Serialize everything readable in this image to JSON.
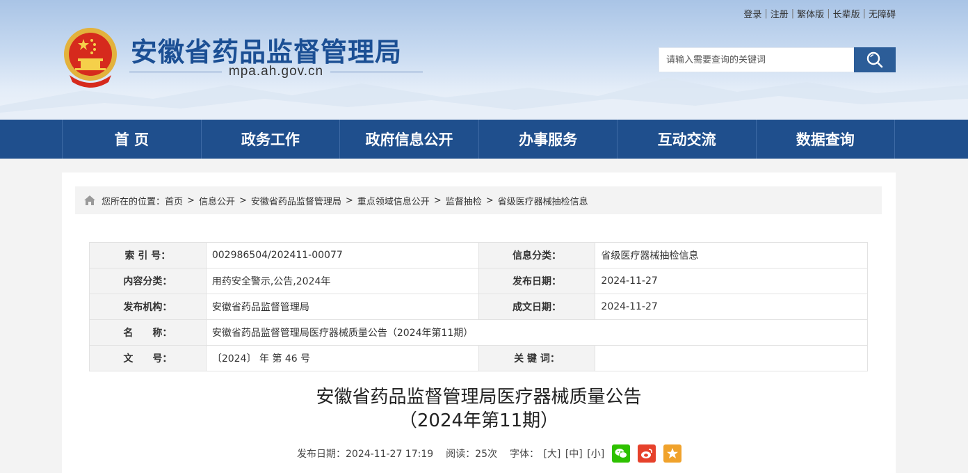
{
  "header": {
    "site_title": "安徽省药品监督管理局",
    "domain": "mpa.ah.gov.cn",
    "toplinks": [
      "登录",
      "注册",
      "繁体版",
      "长辈版",
      "无障碍"
    ],
    "search_placeholder": "请输入需要查询的关键词"
  },
  "nav": [
    "首 页",
    "政务工作",
    "政府信息公开",
    "办事服务",
    "互动交流",
    "数据查询"
  ],
  "breadcrumb": {
    "prefix": "您所在的位置：",
    "items": [
      "首页",
      "信息公开",
      "安徽省药品监督管理局",
      "重点领域信息公开",
      "监督抽检",
      "省级医疗器械抽检信息"
    ]
  },
  "meta": {
    "index_label": "索 引 号：",
    "index_value": "002986504/202411-00077",
    "category_label": "信息分类：",
    "category_value": "省级医疗器械抽检信息",
    "content_label": "内容分类：",
    "content_value": "用药安全警示,公告,2024年",
    "publish_label": "发布日期：",
    "publish_value": "2024-11-27",
    "org_label": "发布机构：",
    "org_value": "安徽省药品监督管理局",
    "written_label": "成文日期：",
    "written_value": "2024-11-27",
    "name_label": "名　　称：",
    "name_value": "安徽省药品监督管理局医疗器械质量公告（2024年第11期）",
    "doc_label": "文　　号：",
    "doc_value": "〔2024〕 年 第 46 号",
    "keyword_label": "关 键 词：",
    "keyword_value": ""
  },
  "article": {
    "title_line1": "安徽省药品监督管理局医疗器械质量公告",
    "title_line2": "（2024年第11期）",
    "publish": "发布日期：2024-11-27 17:19",
    "reads": "阅读：25次",
    "font_label": "字体：",
    "font_large": "[大]",
    "font_medium": "[中]",
    "font_small": "[小]"
  },
  "colors": {
    "brand": "#1f4f8d",
    "title": "#1b4f94",
    "search_button": "#2c5d98"
  },
  "icons": [
    "national-emblem-icon",
    "search-icon",
    "home-icon",
    "wechat-icon",
    "weibo-icon",
    "favorite-icon"
  ]
}
